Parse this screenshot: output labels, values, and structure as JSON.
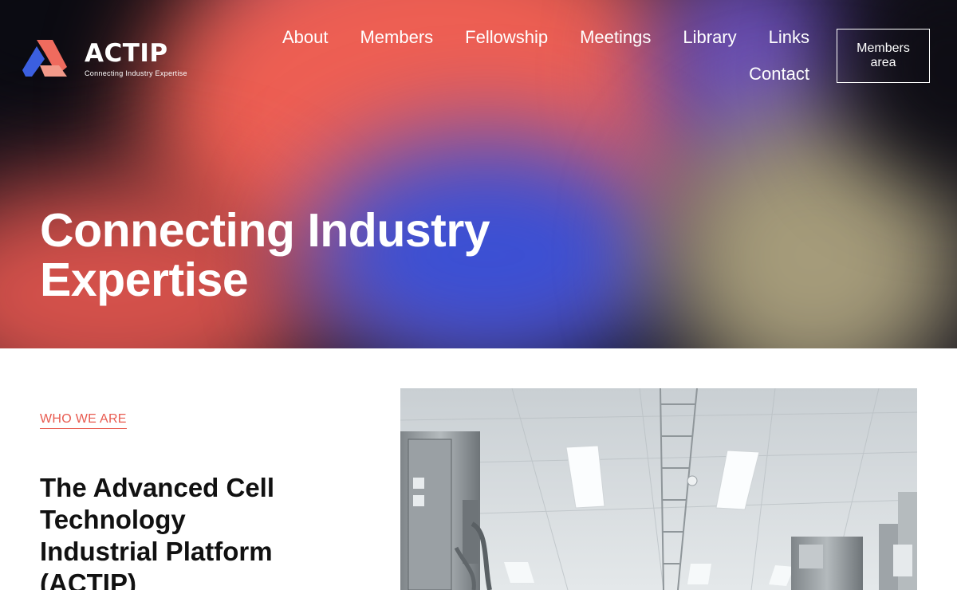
{
  "brand": {
    "name": "ACTIP",
    "tagline": "Connecting  Industry  Expertise",
    "colors": {
      "coral": "#ef6b5e",
      "blue": "#3b5fe0",
      "peach": "#f29a8a"
    }
  },
  "nav": {
    "items": [
      {
        "label": "About"
      },
      {
        "label": "Members"
      },
      {
        "label": "Fellowship"
      },
      {
        "label": "Meetings"
      },
      {
        "label": "Library"
      },
      {
        "label": "Links"
      },
      {
        "label": "Contact"
      }
    ],
    "members_area": {
      "label_line1": "Members",
      "label_line2": "area"
    }
  },
  "hero": {
    "title_line1": "Connecting Industry",
    "title_line2": "Expertise"
  },
  "about": {
    "eyebrow": "WHO WE ARE ",
    "heading_lines": [
      "The Advanced Cell",
      "Technology",
      "Industrial Platform",
      "(ACTIP)"
    ],
    "image_icon": "cleanroom-photo"
  }
}
